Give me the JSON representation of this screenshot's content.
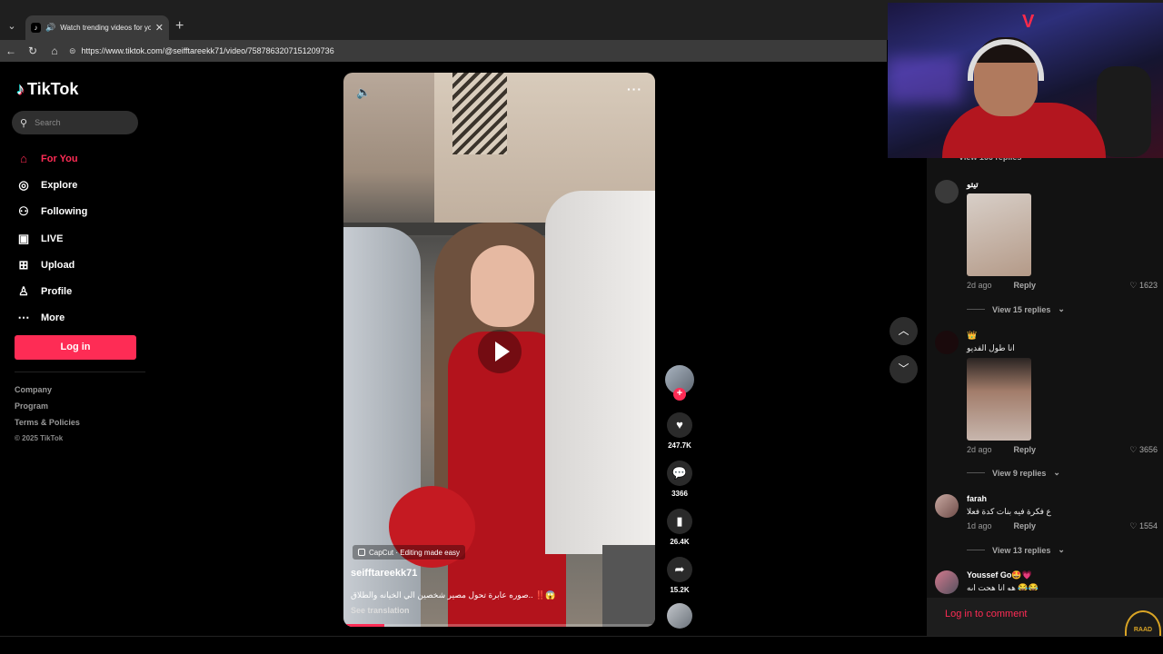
{
  "browser": {
    "tab_title": "Watch trending videos for yo",
    "url": "https://www.tiktok.com/@seifftareekk71/video/7587863207151209736"
  },
  "sidebar": {
    "logo": "TikTok",
    "search_placeholder": "Search",
    "menu": [
      {
        "label": "For You",
        "icon": "home-icon",
        "active": true
      },
      {
        "label": "Explore",
        "icon": "compass-icon"
      },
      {
        "label": "Following",
        "icon": "user-plus-icon"
      },
      {
        "label": "LIVE",
        "icon": "live-icon"
      },
      {
        "label": "Upload",
        "icon": "plus-square-icon"
      },
      {
        "label": "Profile",
        "icon": "person-icon"
      },
      {
        "label": "More",
        "icon": "ellipsis-icon"
      }
    ],
    "login_label": "Log in",
    "footer": [
      "Company",
      "Program",
      "Terms & Policies",
      "© 2025 TikTok"
    ]
  },
  "video": {
    "capcut_label": "CapCut · Editing made easy",
    "author": "seifftareekk71",
    "caption": "صوره عابرة تحول مصير شخصين الي الخيانه والطلاق.. ‼️😱",
    "see_translation": "See translation",
    "progress": 0.13
  },
  "actions": {
    "likes": "247.7K",
    "comments": "3366",
    "saves": "26.4K",
    "shares": "15.2K"
  },
  "comments": {
    "top_view": "View 166 replies",
    "items": [
      {
        "name": "تيتو",
        "time": "2d ago",
        "reply": "Reply",
        "likes": "1623",
        "view": "View 15 replies"
      },
      {
        "name": "👑",
        "text": "انا طول الفديو",
        "time": "2d ago",
        "reply": "Reply",
        "likes": "3656",
        "view": "View 9 replies"
      },
      {
        "name": "farah",
        "text": "ع فكرة فيه بنات كدة فعلا",
        "time": "1d ago",
        "reply": "Reply",
        "likes": "1554",
        "view": "View 13 replies"
      },
      {
        "name": "Youssef Go🤩💗",
        "text": "هو انا هحت ابه 😂😂"
      }
    ],
    "login_label": "Log in to comment"
  },
  "overlay": {
    "watermark": "RAAD"
  }
}
